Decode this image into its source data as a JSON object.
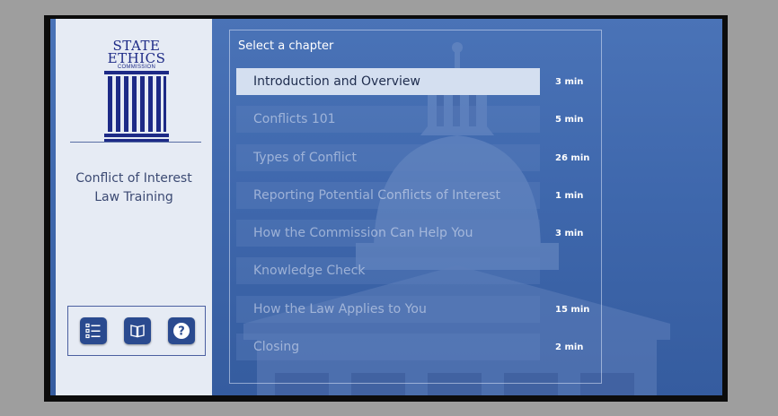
{
  "sidebar": {
    "logo": {
      "line1": "State",
      "line2": "Ethics",
      "line3": "Commission"
    },
    "course_title_line1": "Conflict of Interest",
    "course_title_line2": "Law Training",
    "toolbar": [
      {
        "icon": "list-icon"
      },
      {
        "icon": "book-icon"
      },
      {
        "icon": "help-icon"
      }
    ]
  },
  "menu": {
    "heading": "Select a chapter",
    "chapters": [
      {
        "title": "Introduction and Overview",
        "duration": "3 min",
        "active": true
      },
      {
        "title": "Conflicts 101",
        "duration": "5 min",
        "active": false
      },
      {
        "title": "Types of Conflict",
        "duration": "26 min",
        "active": false
      },
      {
        "title": "Reporting Potential Conflicts of Interest",
        "duration": "1 min",
        "active": false
      },
      {
        "title": "How the Commission Can Help You",
        "duration": "3 min",
        "active": false
      },
      {
        "title": "Knowledge Check",
        "duration": "",
        "active": false
      },
      {
        "title": "How the Law Applies to You",
        "duration": "15 min",
        "active": false
      },
      {
        "title": "Closing",
        "duration": "2 min",
        "active": false
      }
    ]
  },
  "colors": {
    "sidebar_bg": "#e6ebf4",
    "logo_blue": "#1d2a86",
    "button_blue": "#2a4a8f",
    "active_row": "#d4dff0"
  }
}
